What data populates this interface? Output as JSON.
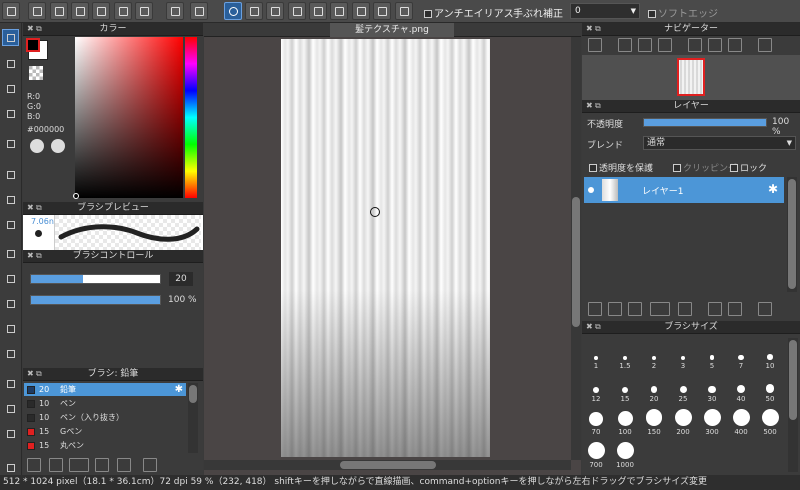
{
  "toolbar": {
    "antialias": "アンチエイリアス",
    "stabilizer_label": "手ぶれ補正",
    "stabilizer_value": "0",
    "soft_edge": "ソフトエッジ"
  },
  "panels": {
    "color": {
      "title": "カラー",
      "r": "R:0",
      "g": "G:0",
      "b": "B:0",
      "hex": "#000000"
    },
    "brush_preview": {
      "title": "ブラシプレビュー",
      "size": "7.06n"
    },
    "brush_control": {
      "title": "ブラシコントロール",
      "size_value": "20",
      "opacity_value": "100 %",
      "size_fraction": 0.4,
      "opacity_fraction": 1.0
    },
    "brush_list": {
      "title": "ブラシ: 鉛筆",
      "items": [
        {
          "size": "20",
          "name": "鉛筆",
          "color": "#1e3c64",
          "selected": true
        },
        {
          "size": "10",
          "name": "ペン",
          "color": "#2a2a2a",
          "selected": false
        },
        {
          "size": "10",
          "name": "ペン（入り抜き）",
          "color": "#2a2a2a",
          "selected": false
        },
        {
          "size": "15",
          "name": "Gペン",
          "color": "#e02020",
          "selected": false
        },
        {
          "size": "15",
          "name": "丸ペン",
          "color": "#e02020",
          "selected": false
        }
      ]
    },
    "navigator": {
      "title": "ナビゲーター"
    },
    "layer": {
      "title": "レイヤー",
      "opacity_label": "不透明度",
      "opacity_value": "100 %",
      "opacity_fraction": 1.0,
      "blend_label": "ブレンド",
      "blend_value": "通常",
      "protect_alpha": "透明度を保護",
      "clipping": "クリッピング",
      "lock": "ロック",
      "layer_name": "レイヤー1"
    },
    "brush_size": {
      "title": "ブラシサイズ",
      "sizes": [
        "1",
        "1.5",
        "2",
        "3",
        "5",
        "7",
        "10",
        "12",
        "15",
        "20",
        "25",
        "30",
        "40",
        "50",
        "70",
        "100",
        "150",
        "200",
        "300",
        "400",
        "500",
        "700",
        "1000"
      ]
    }
  },
  "canvas": {
    "tab": "髪テクスチャ.png"
  },
  "status": {
    "text": "512 * 1024 pixel（18.1 * 36.1cm）72 dpi  59 %（232, 418） shiftキーを押しながらで直線描画、command+optionキーを押しながら左右ドラッグでブラシサイズ変更"
  },
  "colors": {
    "accent": "#4c96d7",
    "fg": "#000000",
    "bg": "#ffffff"
  }
}
